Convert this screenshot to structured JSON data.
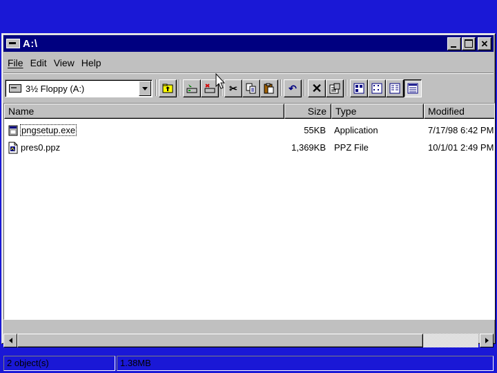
{
  "window": {
    "title": "A:\\",
    "caption_buttons": [
      "minimize",
      "maximize",
      "close"
    ],
    "close_glyph": "✕"
  },
  "menu": [
    {
      "label": "File"
    },
    {
      "label": "Edit"
    },
    {
      "label": "View"
    },
    {
      "label": "Help"
    }
  ],
  "toolbar": {
    "drive_combo": {
      "value": "3½ Floppy (A:)",
      "icon": "floppy-drive-icon"
    },
    "buttons": [
      {
        "name": "up-one-level",
        "icon": "folder-up-icon"
      },
      {
        "name": "map-network-drive",
        "icon": "map-drive-icon"
      },
      {
        "name": "disconnect-network-drive",
        "icon": "disconnect-drive-icon"
      },
      {
        "name": "cut",
        "icon": "scissors-icon",
        "glyph": "✂"
      },
      {
        "name": "copy",
        "icon": "copy-icon"
      },
      {
        "name": "paste",
        "icon": "paste-icon"
      },
      {
        "name": "undo",
        "icon": "undo-icon",
        "glyph": "↶"
      },
      {
        "name": "delete",
        "icon": "delete-icon",
        "glyph": "✕"
      },
      {
        "name": "properties",
        "icon": "properties-icon"
      },
      {
        "name": "large-icons",
        "icon": "large-icons-view-icon"
      },
      {
        "name": "small-icons",
        "icon": "small-icons-view-icon"
      },
      {
        "name": "list",
        "icon": "list-view-icon"
      },
      {
        "name": "details",
        "icon": "details-view-icon",
        "pressed": true
      }
    ]
  },
  "columns": [
    {
      "label": "Name"
    },
    {
      "label": "Size"
    },
    {
      "label": "Type"
    },
    {
      "label": "Modified"
    }
  ],
  "files": [
    {
      "name": "pngsetup.exe",
      "size": "55KB",
      "type": "Application",
      "modified": "7/17/98 6:42 PM",
      "icon": "application-icon"
    },
    {
      "name": "pres0.ppz",
      "size": "1,369KB",
      "type": "PPZ File",
      "modified": "10/1/01 2:49 PM",
      "icon": "document-icon"
    }
  ],
  "status": {
    "objects": "2 object(s)",
    "size": "1.38MB"
  },
  "colors": {
    "desktop": "#1a18d6",
    "titlebar": "#000080",
    "face": "#c0c0c0"
  }
}
